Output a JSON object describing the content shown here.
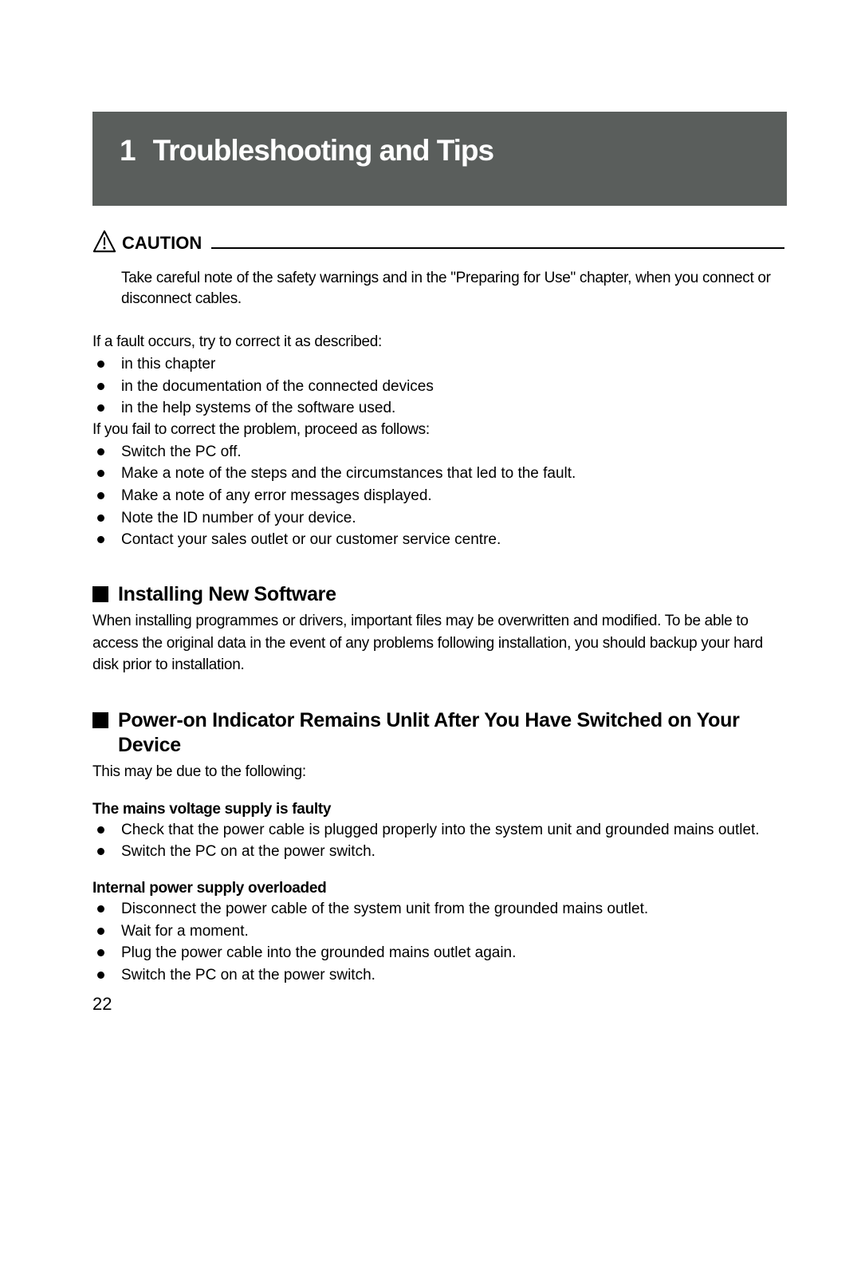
{
  "titlebar": {
    "num": "1",
    "text": "Troubleshooting and Tips"
  },
  "caution": {
    "label": "CAUTION",
    "text": "Take careful note of the safety warnings and in the \"Preparing for Use\" chapter, when you connect or disconnect cables."
  },
  "intro1": "If a fault occurs, try to correct it as described:",
  "list1": [
    "in this chapter",
    "in the documentation of the connected devices",
    "in the help systems of the software used."
  ],
  "intro2": "If you fail to correct the problem, proceed as follows:",
  "list2": [
    "Switch the PC off.",
    "Make a note of the steps and the circumstances that led to the fault.",
    "Make a note of any error messages displayed.",
    "Note the ID number of your device.",
    "Contact your sales outlet or our customer service centre."
  ],
  "sec1": {
    "title": "Installing New Software",
    "para": "When installing programmes or drivers, important files may be overwritten and modified. To be able to access the original data in the event of any problems following installation, you should backup your hard disk prior to installation."
  },
  "sec2": {
    "title": "Power-on Indicator Remains Unlit After You Have Switched on Your Device",
    "intro": "This may be due to the following:",
    "sub1_title": "The mains voltage supply is faulty",
    "sub1_list": [
      "Check that the power cable is plugged properly into the system unit and grounded mains outlet.",
      "Switch the PC on at the power switch."
    ],
    "sub2_title": "Internal power supply overloaded",
    "sub2_list": [
      "Disconnect the power cable of the system unit from the grounded mains outlet.",
      "Wait for a moment.",
      "Plug the power cable into the grounded mains outlet again.",
      "Switch the PC on at the power switch."
    ]
  },
  "page_number": "22"
}
